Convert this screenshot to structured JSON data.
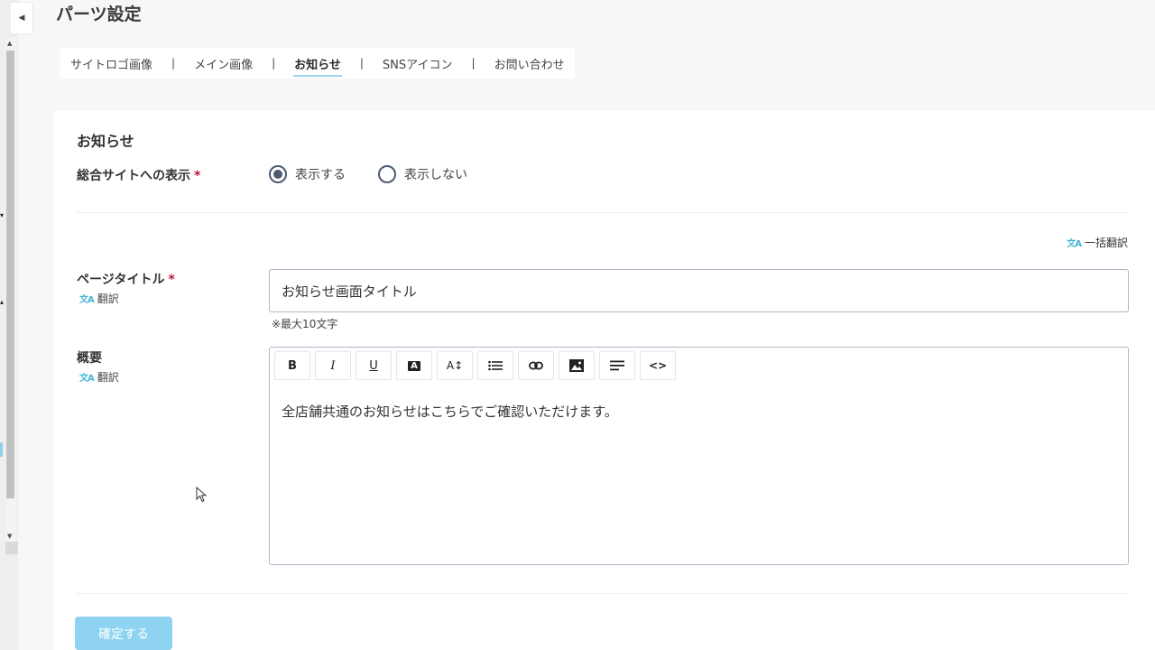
{
  "page": {
    "title": "パーツ設定"
  },
  "tabs": [
    {
      "label": "サイトロゴ画像",
      "active": false
    },
    {
      "label": "メイン画像",
      "active": false
    },
    {
      "label": "お知らせ",
      "active": true
    },
    {
      "label": "SNSアイコン",
      "active": false
    },
    {
      "label": "お問い合わせ",
      "active": false
    }
  ],
  "tab_separator": "|",
  "section": {
    "title": "お知らせ",
    "display_label": "総合サイトへの表示",
    "required_mark": "*",
    "radio_options": [
      {
        "label": "表示する",
        "checked": true
      },
      {
        "label": "表示しない",
        "checked": false
      }
    ],
    "bulk_translate": "一括翻訳",
    "translate_icon": "文A",
    "page_title_label": "ページタイトル",
    "translate_label": "翻訳",
    "page_title_value": "お知らせ画面タイトル",
    "page_title_hint": "※最大10文字",
    "summary_label": "概要",
    "toolbar": [
      {
        "icon": "bold-icon",
        "glyph": "B"
      },
      {
        "icon": "italic-icon",
        "glyph": "I"
      },
      {
        "icon": "underline-icon",
        "glyph": "U"
      },
      {
        "icon": "text-color-icon",
        "glyph": "A"
      },
      {
        "icon": "font-size-icon",
        "glyph": "A↕"
      },
      {
        "icon": "list-icon",
        "glyph": "☰"
      },
      {
        "icon": "link-icon",
        "glyph": "⊂⊃"
      },
      {
        "icon": "image-icon",
        "glyph": "▣"
      },
      {
        "icon": "align-icon",
        "glyph": "≡"
      },
      {
        "icon": "code-icon",
        "glyph": "<>"
      }
    ],
    "summary_text": "全店舗共通のお知らせはこちらでご確認いただけます。"
  },
  "confirm_button": "確定する",
  "colors": {
    "accent": "#8fd3f2",
    "required": "#c0143c",
    "radio": "#4d5a73",
    "tab_underline": "#9cd3ef",
    "translate_icon": "#45b3d9"
  }
}
